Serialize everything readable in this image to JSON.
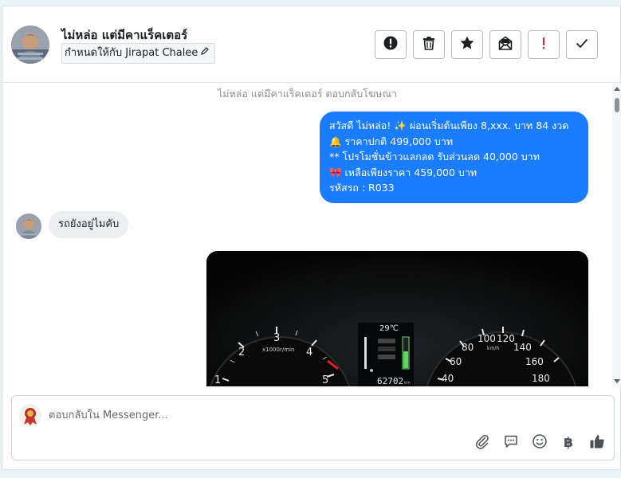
{
  "header": {
    "contact_name": "ไม่หล่อ แต่มีคาแร็คเตอร์",
    "assign_label": "กำหนดให้กับ Jirapat Chalee",
    "actions": [
      "spam-icon",
      "trash-icon",
      "star-icon",
      "mark-unread-icon",
      "important-icon",
      "check-icon"
    ]
  },
  "thread": {
    "system_note": "ไม่หล่อ แต่มีคาแร็คเตอร์ ตอบกลับโฆษณา",
    "outgoing_lines": [
      "สวัสดี ไม่หล่อ! ✨  ผ่อนเริ่มต้นเพียง 8,xxx. บาท 84 งวด",
      "🔔 ราคาปกติ 499,000 บาท",
      "** โปรโมชั่นข้าวแลกลด รับส่วนลด 40,000 บาท",
      "🎀  เหลือเพียงราคา 459,000 บาท",
      " รหัสรถ : R033"
    ],
    "incoming_text": "รถยังอยู่ไมคับ",
    "photo": {
      "temperature": "29℃",
      "odometer": "62702",
      "odometer_unit": "km",
      "tacho_label": "x1000r/min",
      "tacho_ticks": [
        "1",
        "2",
        "3",
        "4",
        "5"
      ],
      "speed_unit": "km/h",
      "speed_ticks": [
        "40",
        "60",
        "80",
        "100",
        "120",
        "140",
        "160",
        "180"
      ]
    }
  },
  "composer": {
    "placeholder": "ตอบกลับใน Messenger...",
    "tools": [
      "attachment-icon",
      "saved-reply-icon",
      "emoji-icon",
      "baht-icon",
      "thumbs-up-icon"
    ],
    "baht_glyph": "฿"
  },
  "colors": {
    "brand_blue": "#1a7cff",
    "incoming_bubble": "#eceef1",
    "danger_red": "#e02a2a"
  }
}
